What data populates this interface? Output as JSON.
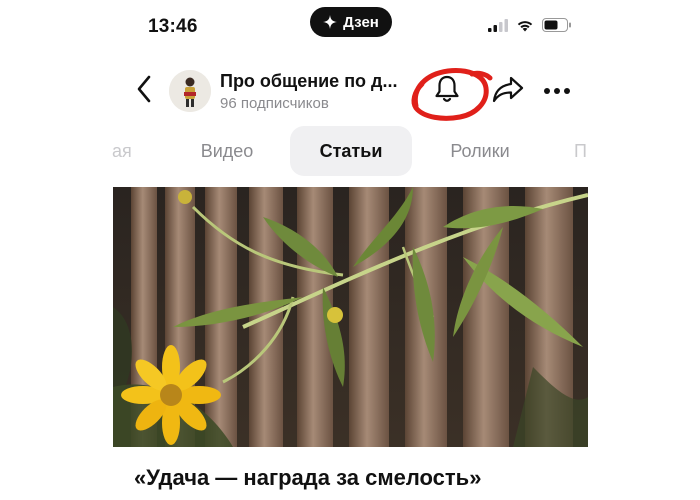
{
  "status_bar": {
    "time": "13:46",
    "app_pill": "Дзен"
  },
  "channel": {
    "name": "Про общение по д...",
    "subscribers": "96 подписчиков"
  },
  "tabs": [
    {
      "label": "ая",
      "active": false
    },
    {
      "label": "Видео",
      "active": false
    },
    {
      "label": "Статьи",
      "active": true
    },
    {
      "label": "Ролики",
      "active": false
    },
    {
      "label": "П",
      "active": false
    }
  ],
  "article": {
    "title": "«Удача — награда за смелость»"
  },
  "annotation": {
    "color": "#e0201a",
    "target": "bell-icon"
  },
  "colors": {
    "text": "#111111",
    "muted": "#8a8a8e",
    "active_tab_bg": "#f0f0f2"
  }
}
